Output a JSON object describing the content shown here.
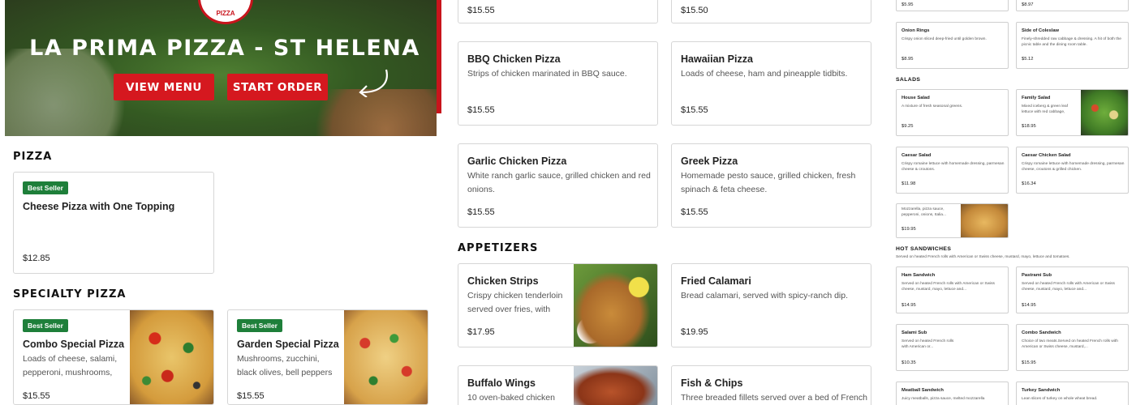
{
  "hero": {
    "logo_text": "PIZZA",
    "title": "LA PRIMA PIZZA - ST HELENA",
    "view_menu": "VIEW MENU",
    "start_order": "START ORDER",
    "colors": {
      "red": "#d5181f",
      "brand_green": "#1e7f3a"
    }
  },
  "pizza": {
    "section_title": "PIZZA",
    "items": [
      {
        "badge": "Best Seller",
        "name": "Cheese Pizza with One Topping",
        "price": "$12.85"
      }
    ]
  },
  "specialty": {
    "section_title": "SPECIALTY PIZZA",
    "items": [
      {
        "badge": "Best Seller",
        "name": "Combo Special Pizza",
        "desc": "Loads of cheese, salami, pepperoni, mushrooms,",
        "price": "$15.55"
      },
      {
        "badge": "Best Seller",
        "name": "Garden Special Pizza",
        "desc": "Mushrooms, zucchini, black olives, bell peppers",
        "price": "$15.55"
      }
    ]
  },
  "panel2": {
    "top_prices": [
      "$15.55",
      "$15.50"
    ],
    "pizzas": [
      {
        "name": "BBQ Chicken Pizza",
        "desc": "Strips of chicken marinated in BBQ sauce.",
        "price": "$15.55"
      },
      {
        "name": "Hawaiian Pizza",
        "desc": "Loads of cheese, ham and pineapple tidbits.",
        "price": "$15.55"
      },
      {
        "name": "Garlic Chicken Pizza",
        "desc": "White ranch garlic sauce, grilled chicken and red onions.",
        "price": "$15.55"
      },
      {
        "name": "Greek Pizza",
        "desc": "Homemade pesto sauce, grilled chicken, fresh spinach & feta cheese.",
        "price": "$15.55"
      }
    ],
    "appetizers_title": "APPETIZERS",
    "appetizers": [
      {
        "name": "Chicken Strips",
        "desc": "Crispy chicken tenderloin served over fries, with yo...",
        "price": "$17.95"
      },
      {
        "name": "Fried Calamari",
        "desc": "Bread calamari, served with spicy-ranch dip.",
        "price": "$19.95"
      },
      {
        "name": "Buffalo Wings",
        "desc": "10 oven-baked chicken",
        "price": ""
      },
      {
        "name": "Fish & Chips",
        "desc": "Three breaded fillets served over a bed of French",
        "price": ""
      }
    ]
  },
  "panel3": {
    "top_prices": [
      "$5.95",
      "$8.97"
    ],
    "sides": [
      {
        "name": "Onion Rings",
        "desc": "Crispy onion sliced deep-fried until golden brown.",
        "price": "$8.95"
      },
      {
        "name": "Side of Coleslaw",
        "desc": "Finely-shredded raw cabbage & dressing. A hit of both the picnic table and the dining room table.",
        "price": "$5.12"
      }
    ],
    "salads_title": "SALADS",
    "salads": [
      {
        "name": "House Salad",
        "desc": "A mixture of fresh seasonal greens.",
        "price": "$9.25"
      },
      {
        "name": "Family Salad",
        "desc": "Mixed iceberg & green leaf lettuce with red cabbage,",
        "price": "$18.95"
      },
      {
        "name": "Caesar Salad",
        "desc": "Crispy romaine lettuce with homemade dressing, parmesan cheese & croutons.",
        "price": "$11.98"
      },
      {
        "name": "Caesar Chicken Salad",
        "desc": "Crispy romaine lettuce with homemade dressing, parmesan cheese, croutons & grilled chicken.",
        "price": "$16.34"
      },
      {
        "name": "",
        "desc": "Mozzarella, pizza sauce, pepperoni, onions, Italia...",
        "price": "$19.95"
      }
    ],
    "sandwiches_title": "HOT SANDWICHES",
    "sandwiches_sub": "Served on heated French rolls with American or Swiss cheese, mustard, mayo, lettuce and tomatoes.",
    "sandwiches": [
      {
        "name": "Ham Sandwich",
        "desc": "Served on heated French rolls with American or Swiss cheese, mustard, mayo, lettuce and...",
        "price": "$14.95"
      },
      {
        "name": "Pastrami Sub",
        "desc": "Served on heated French rolls with American or Swiss cheese, mustard, mayo, lettuce and...",
        "price": "$14.95"
      },
      {
        "name": "Salami Sub",
        "desc": "Served on heated French rolls with American or...",
        "price": "$10.35"
      },
      {
        "name": "Combo Sandwich",
        "desc": "Choice of two meats.Served on heated French rolls with American or Swiss cheese, mustard,...",
        "price": "$15.95"
      },
      {
        "name": "Meatball Sandwich",
        "desc": "Juicy meatballs, pizza sauce, melted mozzarella",
        "price": ""
      },
      {
        "name": "Turkey Sandwich",
        "desc": "Lean slices of turkey on whole wheat bread.",
        "price": ""
      }
    ]
  }
}
